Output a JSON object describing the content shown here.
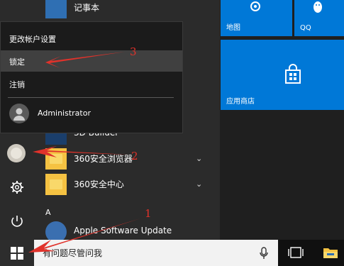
{
  "account_menu": {
    "change_settings_label": "更改帐户设置",
    "lock_label": "锁定",
    "sign_out_label": "注销",
    "user_name": "Administrator"
  },
  "apps": [
    {
      "label": "记事本",
      "icon": "notepad-icon"
    },
    {
      "label": "3D Builder",
      "icon": "3d-builder-icon"
    },
    {
      "label": "360安全浏览器",
      "icon": "folder-icon"
    },
    {
      "label": "360安全中心",
      "icon": "folder-icon"
    },
    {
      "label": "Apple Software Update",
      "icon": "apple-update-icon"
    }
  ],
  "section_letter": "A",
  "tiles": {
    "maps_label": "地图",
    "qq_label": "QQ",
    "store_label": "应用商店"
  },
  "taskbar": {
    "search_placeholder": "有问题尽管问我"
  },
  "annotations": {
    "num1": "1",
    "num2": "2",
    "num3": "3"
  },
  "colors": {
    "tile_blue": "#0078d7",
    "annotation_red": "#e0322b",
    "menu_highlight": "#404040"
  }
}
